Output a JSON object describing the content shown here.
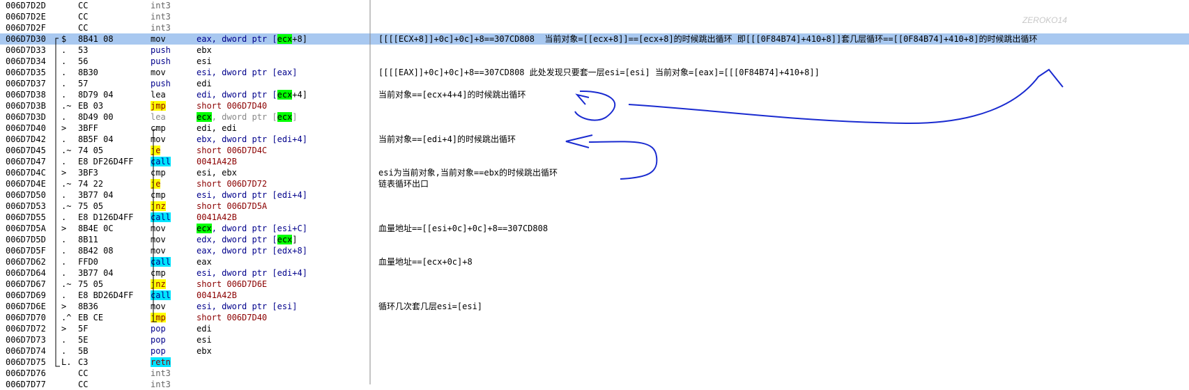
{
  "watermark": "ZEROKO14",
  "rows": [
    {
      "addr": "006D7D2D",
      "mk": "",
      "bytes": "CC",
      "op": "int3",
      "op_style": "cc",
      "args": [],
      "comment": ""
    },
    {
      "addr": "006D7D2E",
      "mk": "",
      "bytes": "CC",
      "op": "int3",
      "op_style": "cc",
      "args": [],
      "comment": ""
    },
    {
      "addr": "006D7D2F",
      "mk": "",
      "bytes": "CC",
      "op": "int3",
      "op_style": "cc",
      "args": [],
      "comment": ""
    },
    {
      "addr": "006D7D30",
      "mk": "$",
      "bytes": "8B41 08",
      "op": "mov",
      "op_style": "plain",
      "args": [
        {
          "t": "eax, dword ptr ["
        },
        {
          "t": "ecx",
          "reg": true
        },
        {
          "t": "+8]"
        }
      ],
      "comment": "[[[[ECX+8]]+0c]+0c]+8==307CD808  当前对象=[[ecx+8]]==[ecx+8]的时候跳出循环 即[[[0F84B74]+410+8]]套几层循环==[[0F84B74]+410+8]的时候跳出循环",
      "selected": true
    },
    {
      "addr": "006D7D33",
      "mk": ".",
      "bytes": "53",
      "op": "push",
      "op_style": "push",
      "args": [
        {
          "t": "ebx"
        }
      ],
      "comment": ""
    },
    {
      "addr": "006D7D34",
      "mk": ".",
      "bytes": "56",
      "op": "push",
      "op_style": "push",
      "args": [
        {
          "t": "esi"
        }
      ],
      "comment": ""
    },
    {
      "addr": "006D7D35",
      "mk": ".",
      "bytes": "8B30",
      "op": "mov",
      "op_style": "plain",
      "args": [
        {
          "t": "esi, dword ptr [eax]"
        }
      ],
      "comment": "[[[[EAX]]+0c]+0c]+8==307CD808 此处发现只要套一层esi=[esi] 当前对象=[eax]=[[[0F84B74]+410+8]]"
    },
    {
      "addr": "006D7D37",
      "mk": ".",
      "bytes": "57",
      "op": "push",
      "op_style": "push",
      "args": [
        {
          "t": "edi"
        }
      ],
      "comment": ""
    },
    {
      "addr": "006D7D38",
      "mk": ".",
      "bytes": "8D79 04",
      "op": "lea",
      "op_style": "plain",
      "args": [
        {
          "t": "edi, dword ptr ["
        },
        {
          "t": "ecx",
          "reg": true
        },
        {
          "t": "+4]"
        }
      ],
      "comment": "当前对象==[ecx+4+4]的时候跳出循环"
    },
    {
      "addr": "006D7D3B",
      "mk": ".~",
      "bytes": "EB 03",
      "op": "jmp",
      "op_style": "jmp",
      "args": [
        {
          "t": "short 006D7D40",
          "jmp": true
        }
      ],
      "comment": ""
    },
    {
      "addr": "006D7D3D",
      "mk": ".",
      "bytes": "8D49 00",
      "op": "lea",
      "op_style": "grey",
      "args": [
        {
          "t": "ecx",
          "reg": true
        },
        {
          "t": ", dword ptr ["
        },
        {
          "t": "ecx",
          "reg": true
        },
        {
          "t": "]"
        }
      ],
      "comment": ""
    },
    {
      "addr": "006D7D40",
      "mk": ">",
      "bytes": "3BFF",
      "op": "cmp",
      "op_style": "plain",
      "args": [
        {
          "t": "edi, edi"
        }
      ],
      "comment": ""
    },
    {
      "addr": "006D7D42",
      "mk": ".",
      "bytes": "8B5F 04",
      "op": "mov",
      "op_style": "plain",
      "args": [
        {
          "t": "ebx, dword ptr [edi+4]"
        }
      ],
      "comment": "当前对象==[edi+4]的时候跳出循环"
    },
    {
      "addr": "006D7D45",
      "mk": ".~",
      "bytes": "74 05",
      "op": "je",
      "op_style": "jcc",
      "args": [
        {
          "t": "short 006D7D4C",
          "jmp": true
        }
      ],
      "comment": ""
    },
    {
      "addr": "006D7D47",
      "mk": ".",
      "bytes": "E8 DF26D4FF",
      "op": "call",
      "op_style": "call",
      "args": [
        {
          "t": "0041A42B",
          "jmp": true
        }
      ],
      "comment": ""
    },
    {
      "addr": "006D7D4C",
      "mk": ">",
      "bytes": "3BF3",
      "op": "cmp",
      "op_style": "plain",
      "args": [
        {
          "t": "esi, ebx"
        }
      ],
      "comment": "esi为当前对象,当前对象==ebx的时候跳出循环"
    },
    {
      "addr": "006D7D4E",
      "mk": ".~",
      "bytes": "74 22",
      "op": "je",
      "op_style": "jcc",
      "args": [
        {
          "t": "short 006D7D72",
          "jmp": true
        }
      ],
      "comment": "链表循环出口"
    },
    {
      "addr": "006D7D50",
      "mk": ".",
      "bytes": "3B77 04",
      "op": "cmp",
      "op_style": "plain",
      "args": [
        {
          "t": "esi, dword ptr [edi+4]"
        }
      ],
      "comment": ""
    },
    {
      "addr": "006D7D53",
      "mk": ".~",
      "bytes": "75 05",
      "op": "jnz",
      "op_style": "jcc",
      "args": [
        {
          "t": "short 006D7D5A",
          "jmp": true
        }
      ],
      "comment": ""
    },
    {
      "addr": "006D7D55",
      "mk": ".",
      "bytes": "E8 D126D4FF",
      "op": "call",
      "op_style": "call",
      "args": [
        {
          "t": "0041A42B",
          "jmp": true
        }
      ],
      "comment": ""
    },
    {
      "addr": "006D7D5A",
      "mk": ">",
      "bytes": "8B4E 0C",
      "op": "mov",
      "op_style": "plain",
      "args": [
        {
          "t": "ecx",
          "reg": true
        },
        {
          "t": ", dword ptr [esi+C]"
        }
      ],
      "comment": "血量地址==[[esi+0c]+0c]+8==307CD808"
    },
    {
      "addr": "006D7D5D",
      "mk": ".",
      "bytes": "8B11",
      "op": "mov",
      "op_style": "plain",
      "args": [
        {
          "t": "edx, dword ptr ["
        },
        {
          "t": "ecx",
          "reg": true
        },
        {
          "t": "]"
        }
      ],
      "comment": ""
    },
    {
      "addr": "006D7D5F",
      "mk": ".",
      "bytes": "8B42 08",
      "op": "mov",
      "op_style": "plain",
      "args": [
        {
          "t": "eax, dword ptr [edx+8]"
        }
      ],
      "comment": ""
    },
    {
      "addr": "006D7D62",
      "mk": ".",
      "bytes": "FFD0",
      "op": "call",
      "op_style": "call",
      "args": [
        {
          "t": "eax"
        }
      ],
      "comment": "血量地址==[ecx+0c]+8"
    },
    {
      "addr": "006D7D64",
      "mk": ".",
      "bytes": "3B77 04",
      "op": "cmp",
      "op_style": "plain",
      "args": [
        {
          "t": "esi, dword ptr [edi+4]"
        }
      ],
      "comment": ""
    },
    {
      "addr": "006D7D67",
      "mk": ".~",
      "bytes": "75 05",
      "op": "jnz",
      "op_style": "jcc",
      "args": [
        {
          "t": "short 006D7D6E",
          "jmp": true
        }
      ],
      "comment": ""
    },
    {
      "addr": "006D7D69",
      "mk": ".",
      "bytes": "E8 BD26D4FF",
      "op": "call",
      "op_style": "call",
      "args": [
        {
          "t": "0041A42B",
          "jmp": true
        }
      ],
      "comment": ""
    },
    {
      "addr": "006D7D6E",
      "mk": ">",
      "bytes": "8B36",
      "op": "mov",
      "op_style": "plain",
      "args": [
        {
          "t": "esi, dword ptr [esi]"
        }
      ],
      "comment": "循环几次套几层esi=[esi]"
    },
    {
      "addr": "006D7D70",
      "mk": ".^",
      "bytes": "EB CE",
      "op": "jmp",
      "op_style": "jmp",
      "args": [
        {
          "t": "short 006D7D40",
          "jmp": true
        }
      ],
      "comment": ""
    },
    {
      "addr": "006D7D72",
      "mk": ">",
      "bytes": "5F",
      "op": "pop",
      "op_style": "push",
      "args": [
        {
          "t": "edi"
        }
      ],
      "comment": ""
    },
    {
      "addr": "006D7D73",
      "mk": ".",
      "bytes": "5E",
      "op": "pop",
      "op_style": "push",
      "args": [
        {
          "t": "esi"
        }
      ],
      "comment": ""
    },
    {
      "addr": "006D7D74",
      "mk": ".",
      "bytes": "5B",
      "op": "pop",
      "op_style": "push",
      "args": [
        {
          "t": "ebx"
        }
      ],
      "comment": ""
    },
    {
      "addr": "006D7D75",
      "mk": "L.",
      "bytes": "C3",
      "op": "retn",
      "op_style": "retn",
      "args": [],
      "comment": ""
    },
    {
      "addr": "006D7D76",
      "mk": "",
      "bytes": "CC",
      "op": "int3",
      "op_style": "cc",
      "args": [],
      "comment": ""
    },
    {
      "addr": "006D7D77",
      "mk": "",
      "bytes": "CC",
      "op": "int3",
      "op_style": "cc",
      "args": [],
      "comment": ""
    }
  ]
}
